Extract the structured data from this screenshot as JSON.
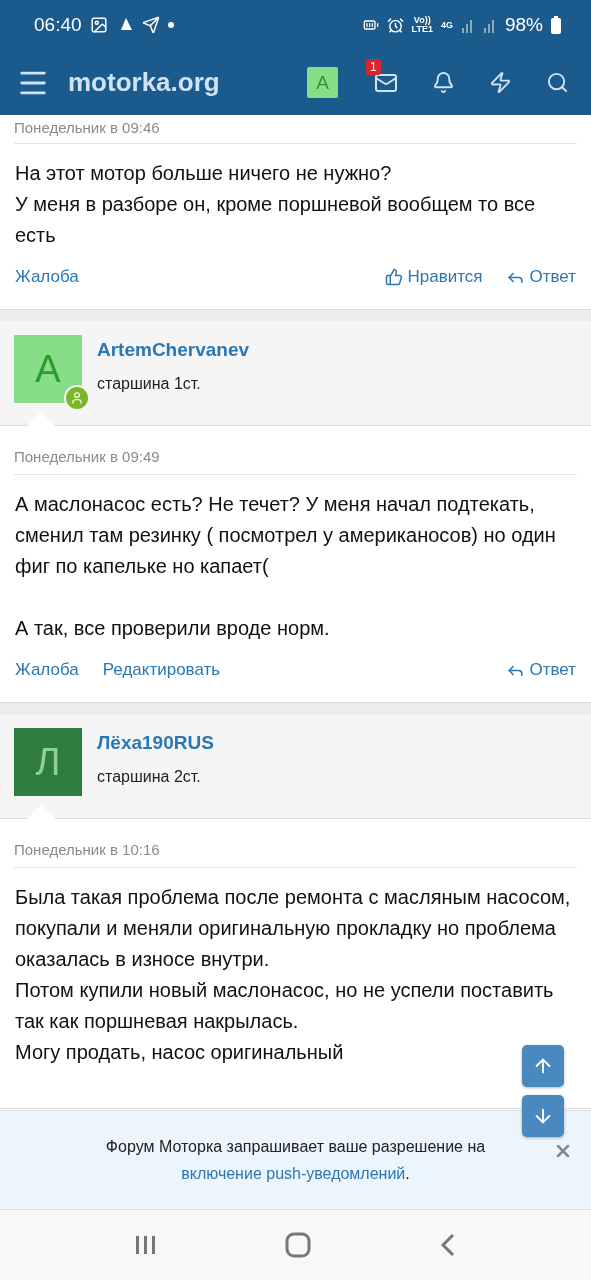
{
  "status_bar": {
    "time": "06:40",
    "volte": "Vo))",
    "lte": "LTE1",
    "network": "4G",
    "battery": "98%"
  },
  "header": {
    "logo": "motorka.org",
    "user_avatar": "A",
    "unread_messages": "1"
  },
  "posts": [
    {
      "date": "Понедельник в 09:46",
      "paragraphs": [
        [
          "На этот мотор больше ничего не нужно?",
          "У меня в разборе он, кроме поршневой вообщем то все есть"
        ]
      ],
      "actions": [
        {
          "kind": "report",
          "label": "Жалоба"
        },
        {
          "kind": "like",
          "label": "Нравится"
        },
        {
          "kind": "reply",
          "label": "Ответ"
        }
      ]
    },
    {
      "author": {
        "name": "ArtemChervanev",
        "role": "старшина 1ст.",
        "avatar_letter": "A",
        "color": "#88dd88",
        "online": true
      },
      "date": "Понедельник в 09:49",
      "paragraphs": [
        [
          "А маслонасос есть? Не течет? У меня начал подтекать, сменил там резинку ( посмотрел у американосов) но один фиг по капельке но капает("
        ],
        [
          "А так, все проверили вроде норм."
        ]
      ],
      "actions": [
        {
          "kind": "report",
          "label": "Жалоба"
        },
        {
          "kind": "edit",
          "label": "Редактировать"
        },
        {
          "kind": "reply",
          "label": "Ответ"
        }
      ]
    },
    {
      "author": {
        "name": "Лёха190RUS",
        "role": "старшина 2ст.",
        "avatar_letter": "Л",
        "color": "#2e7d3e",
        "online": false
      },
      "date": "Понедельник в 10:16",
      "paragraphs": [
        [
          "Была такая проблема после ремонта с масляным насосом, покупали и меняли оригинальную прокладку но проблема оказалась в износе внутри.",
          "Потом купили новый маслонасос, но не успели поставить так как поршневая накрылась.",
          "Могу продать, насос оригинальный"
        ]
      ]
    }
  ],
  "push_notice": {
    "text": "Форум Моторка запрашивает ваше разрешение на",
    "link": "включение push-уведомлений",
    "end": "."
  }
}
